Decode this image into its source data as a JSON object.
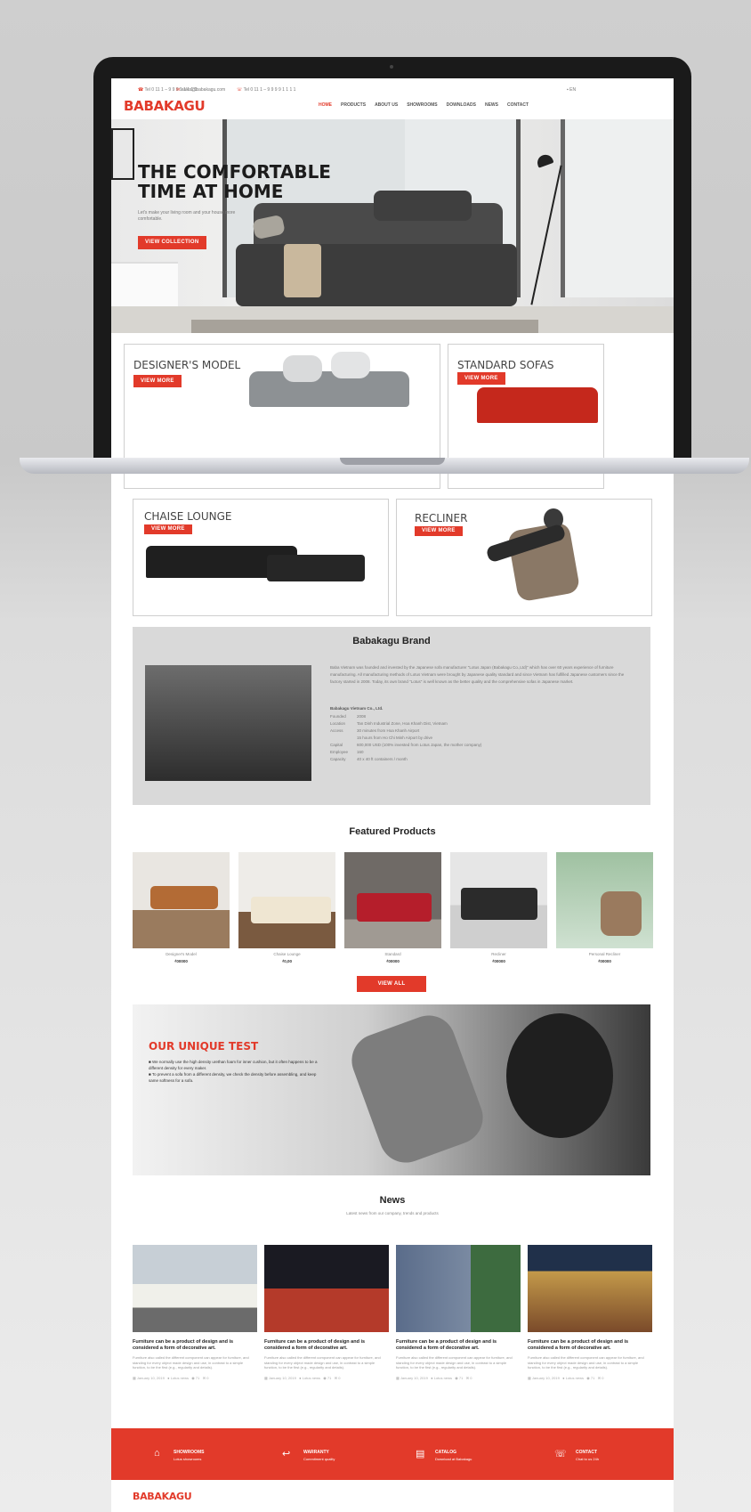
{
  "topbar": {
    "phone": "Tel 0 11 1 – 9 9 9 9 1 1 1 1",
    "email": "sales@babakagu.com",
    "hotline": "Tel 0 11 1 – 9 9 9 9 1 1 1 1",
    "language": "EN"
  },
  "brand": {
    "logo": "BABAKAGU"
  },
  "nav": {
    "items": [
      "HOME",
      "PRODUCTS",
      "ABOUT US",
      "SHOWROOMS",
      "DOWNLOADS",
      "NEWS",
      "CONTACT"
    ]
  },
  "hero": {
    "title_line1": "THE COMFORTABLE",
    "title_line2": "TIME AT HOME",
    "subtitle": "Let's make your living room and your house more comfortable.",
    "cta": "VIEW COLLECTION"
  },
  "categories": [
    {
      "title": "DESIGNER'S MODEL",
      "button": "VIEW MORE"
    },
    {
      "title": "STANDARD SOFAS",
      "button": "VIEW MORE"
    },
    {
      "title": "CHAISE LOUNGE",
      "button": "VIEW MORE"
    },
    {
      "title": "RECLINER",
      "button": "VIEW MORE"
    }
  ],
  "brand_section": {
    "title": "Babakagu Brand",
    "intro": "Baba Vietnam was founded and invested by the Japanese sofa manufacturer \"Lotus Japan (Babakagu Co.,Ltd)\" which has over 60 years experience of furniture manufacturing. All manufacturing methods of Lotus Vietnam were brought by Japanese quality standard and since Vietnam has fulfilled Japanese customers since the factory started in 2008. Today, its own brand \"Lotus\" is well known as the better quality and the comprehensive sofas in Japanese market.",
    "company_name": "Babakagu Vietnam Co., Ltd.",
    "facts": [
      {
        "label": "Founded",
        "value": "2008"
      },
      {
        "label": "Location",
        "value": "Tan Dinh Industrial Zone, Hoa Khanh Dist, Vietnam"
      },
      {
        "label": "Access",
        "value": "30 minutes from Hoa Khanh Airport"
      },
      {
        "label": "",
        "value": "15 hours from Ho Chi Minh Airport by drive"
      },
      {
        "label": "Capital",
        "value": "600,000 USD (100% invested from Lotus Japan, the mother company)"
      },
      {
        "label": "Employee",
        "value": "160"
      },
      {
        "label": "Capacity",
        "value": "40 x 40 ft containers / month"
      }
    ]
  },
  "featured": {
    "title": "Featured Products",
    "view_all": "VIEW ALL",
    "products": [
      {
        "name": "Designer's Model",
        "price": "₫00000"
      },
      {
        "name": "Chaise Lounge",
        "price": "₫0,00"
      },
      {
        "name": "Standard",
        "price": "₫00000"
      },
      {
        "name": "Recliner",
        "price": "₫00000"
      },
      {
        "name": "Personal Recliner",
        "price": "₫00000"
      }
    ]
  },
  "unique_test": {
    "title": "OUR UNIQUE TEST",
    "bullets": [
      "We normally use the high density urethan foam for inner cushion, but it often happens to be a different density for every maker.",
      "To prevent a sofa from a different density, we check the density before assembling, and keep same softness for a sofa."
    ]
  },
  "news": {
    "title": "News",
    "subtitle": "Latest news from our company, trends and products",
    "items": [
      {
        "title": "Furniture can be a product of design and is considered a form of decorative art.",
        "body": "Furniture also called the different component can appear for furniture, and standing for every object made design and use, in contrast to a simple function, to be the first (e.g., regularity and details).",
        "date": "January 10, 2019",
        "author": "Lotus news",
        "views": "71",
        "comments": "0"
      },
      {
        "title": "Furniture can be a product of design and is considered a form of decorative art.",
        "body": "Furniture also called the different component can appear for furniture, and standing for every object made design and use, in contrast to a simple function, to be the first (e.g., regularity and details).",
        "date": "January 10, 2019",
        "author": "Lotus news",
        "views": "71",
        "comments": "0"
      },
      {
        "title": "Furniture can be a product of design and is considered a form of decorative art.",
        "body": "Furniture also called the different component can appear for furniture, and standing for every object made design and use, in contrast to a simple function, to be the first (e.g., regularity and details).",
        "date": "January 10, 2019",
        "author": "Lotus news",
        "views": "71",
        "comments": "0"
      },
      {
        "title": "Furniture can be a product of design and is considered a form of decorative art.",
        "body": "Furniture also called the different component can appear for furniture, and standing for every object made design and use, in contrast to a simple function, to be the first (e.g., regularity and details).",
        "date": "January 10, 2019",
        "author": "Lotus news",
        "views": "71",
        "comments": "0"
      }
    ]
  },
  "footer_bar": {
    "items": [
      {
        "title": "SHOWROOMS",
        "sub": "Lotus showrooms",
        "icon": "home-icon"
      },
      {
        "title": "WARRANTY",
        "sub": "Commitment quality",
        "icon": "return-arrow-icon"
      },
      {
        "title": "CATALOG",
        "sub": "Download at Babakagu",
        "icon": "catalog-icon"
      },
      {
        "title": "CONTACT",
        "sub": "Chat to us 24h",
        "icon": "chat-icon"
      }
    ]
  },
  "footer": {
    "logo": "BABAKAGU"
  },
  "colors": {
    "accent": "#e23a2a",
    "bezel": "#1a1a1a"
  }
}
